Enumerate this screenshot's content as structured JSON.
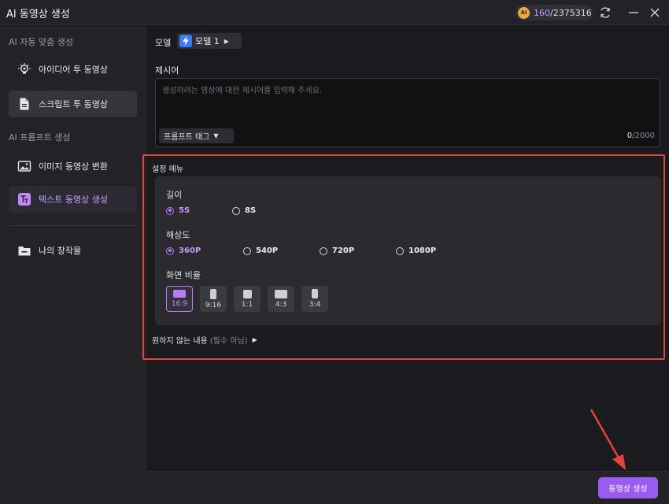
{
  "app": {
    "title": "AI 동영상 생성"
  },
  "credits": {
    "coin_label": "AI",
    "used": "160",
    "separator_total": "/2375316"
  },
  "sidebar": {
    "section_auto": "AI 자동 맞춤 생성",
    "section_prompt": "AI 프롬프트 생성",
    "items": [
      {
        "label": "아이디어 투 동영상",
        "icon": "bulb-icon"
      },
      {
        "label": "스크립트 투 동영상",
        "icon": "document-icon"
      },
      {
        "label": "이미지 동영상 변환",
        "icon": "image-icon"
      },
      {
        "label": "텍스트 동영상 생성",
        "icon": "text-icon"
      },
      {
        "label": "나의 창작물",
        "icon": "folder-icon"
      }
    ]
  },
  "model": {
    "label": "모델",
    "value": "모델 1"
  },
  "prompt": {
    "label": "제시어",
    "placeholder": "생성하려는 영상에 대한 제시어를 입력해 주세요.",
    "tag_button": "프롬프트 태그",
    "count_current": "0",
    "count_max": "/2000"
  },
  "settings": {
    "title": "설정 메뉴",
    "duration": {
      "label": "길이",
      "options": [
        "5S",
        "8S"
      ],
      "selected": "5S"
    },
    "resolution": {
      "label": "해상도",
      "options": [
        "360P",
        "540P",
        "720P",
        "1080P"
      ],
      "selected": "360P"
    },
    "aspect": {
      "label": "화면 비율",
      "options": [
        "16:9",
        "9:16",
        "1:1",
        "4:3",
        "3:4"
      ],
      "selected": "16:9"
    }
  },
  "negative": {
    "label": "원하지 않는 내용",
    "optional": "(필수 아님)"
  },
  "footer": {
    "generate_button": "동영상 생성"
  },
  "colors": {
    "accent": "#9a5cf0",
    "highlight_frame": "#e0453c",
    "background": "#1b1b1f"
  }
}
